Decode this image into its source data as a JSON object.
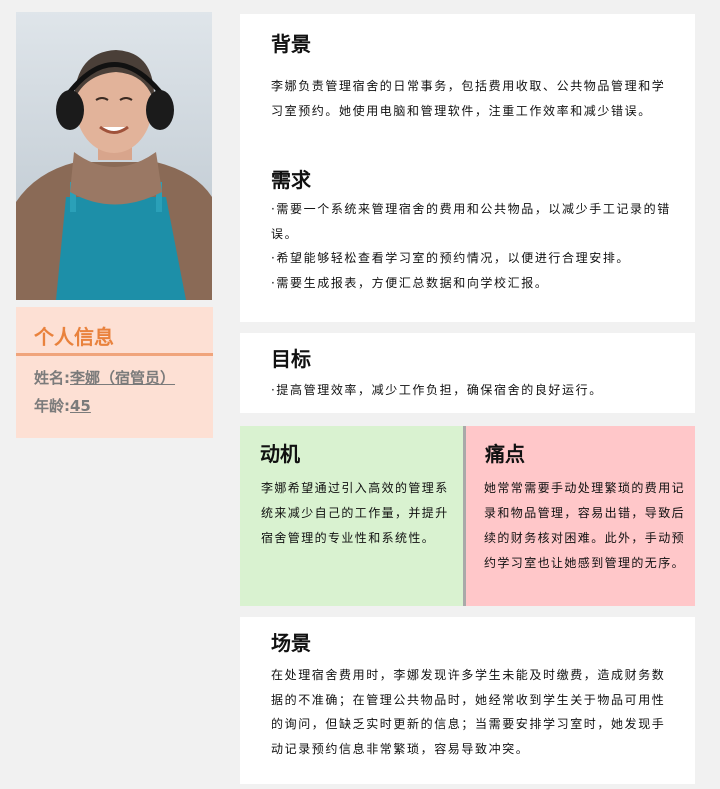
{
  "profile": {
    "title": "个人信息",
    "name_label": "姓名:",
    "name_value": "李娜（宿管员）",
    "age_label": "年龄:",
    "age_value": "45"
  },
  "background": {
    "title": "背景",
    "text": "李娜负责管理宿舍的日常事务，包括费用收取、公共物品管理和学习室预约。她使用电脑和管理软件，注重工作效率和减少错误。"
  },
  "needs": {
    "title": "需求",
    "items": [
      "·需要一个系统来管理宿舍的费用和公共物品，以减少手工记录的错误。",
      "·希望能够轻松查看学习室的预约情况，以便进行合理安排。",
      "·需要生成报表，方便汇总数据和向学校汇报。"
    ]
  },
  "goals": {
    "title": "目标",
    "items": [
      "·提高管理效率，减少工作负担，确保宿舍的良好运行。"
    ]
  },
  "motivation": {
    "title": "动机",
    "text": "李娜希望通过引入高效的管理系统来减少自己的工作量，并提升宿舍管理的专业性和系统性。"
  },
  "pain_points": {
    "title": "痛点",
    "text": "她常常需要手动处理繁琐的费用记录和物品管理，容易出错，导致后续的财务核对困难。此外，手动预约学习室也让她感到管理的无序。"
  },
  "scenario": {
    "title": "场景",
    "text": "在处理宿舍费用时，李娜发现许多学生未能及时缴费，造成财务数据的不准确；在管理公共物品时，她经常收到学生关于物品可用性的询问，但缺乏实时更新的信息；当需要安排学习室时，她发现手动记录预约信息非常繁琐，容易导致冲突。"
  },
  "colors": {
    "profile_title": "#e9823d",
    "profile_bg": "#fde0d4",
    "motivation_bg": "#d9f2d0",
    "pain_bg": "#ffc7c9"
  }
}
